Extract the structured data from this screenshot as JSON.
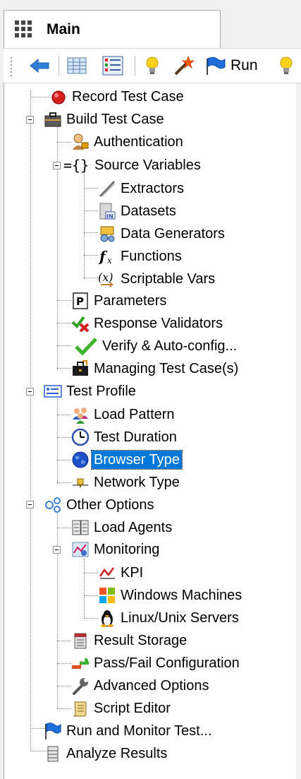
{
  "tab": {
    "title": "Main",
    "icon": "grid-icon"
  },
  "toolbar": {
    "buttons": [
      {
        "icon": "back-arrow-icon"
      },
      {
        "icon": "table-view-icon"
      },
      {
        "icon": "list-view-icon"
      },
      {
        "icon": "lightbulb-icon"
      },
      {
        "icon": "magic-wand-icon"
      },
      {
        "icon": "flag-icon",
        "label": "Run"
      },
      {
        "icon": "lightbulb-icon"
      }
    ]
  },
  "tree": {
    "record_test_case": "Record Test Case",
    "build_test_case": "Build Test Case",
    "authentication": "Authentication",
    "source_variables": "Source Variables",
    "extractors": "Extractors",
    "datasets": "Datasets",
    "data_generators": "Data Generators",
    "functions": "Functions",
    "scriptable_vars": "Scriptable Vars",
    "parameters": "Parameters",
    "response_validators": "Response Validators",
    "verify_autoconfig": "Verify & Auto-config...",
    "managing_test_cases": "Managing Test Case(s)",
    "test_profile": "Test Profile",
    "load_pattern": "Load Pattern",
    "test_duration": "Test Duration",
    "browser_type": "Browser Type",
    "network_type": "Network Type",
    "other_options": "Other Options",
    "load_agents": "Load Agents",
    "monitoring": "Monitoring",
    "kpi": "KPI",
    "windows_machines": "Windows Machines",
    "linux_unix_servers": "Linux/Unix Servers",
    "result_storage": "Result Storage",
    "pass_fail_configuration": "Pass/Fail Configuration",
    "advanced_options": "Advanced Options",
    "script_editor": "Script Editor",
    "run_and_monitor_test": "Run and Monitor Test...",
    "analyze_results": "Analyze Results"
  },
  "selected_item": "Browser Type",
  "colors": {
    "selection": "#0078d7"
  }
}
